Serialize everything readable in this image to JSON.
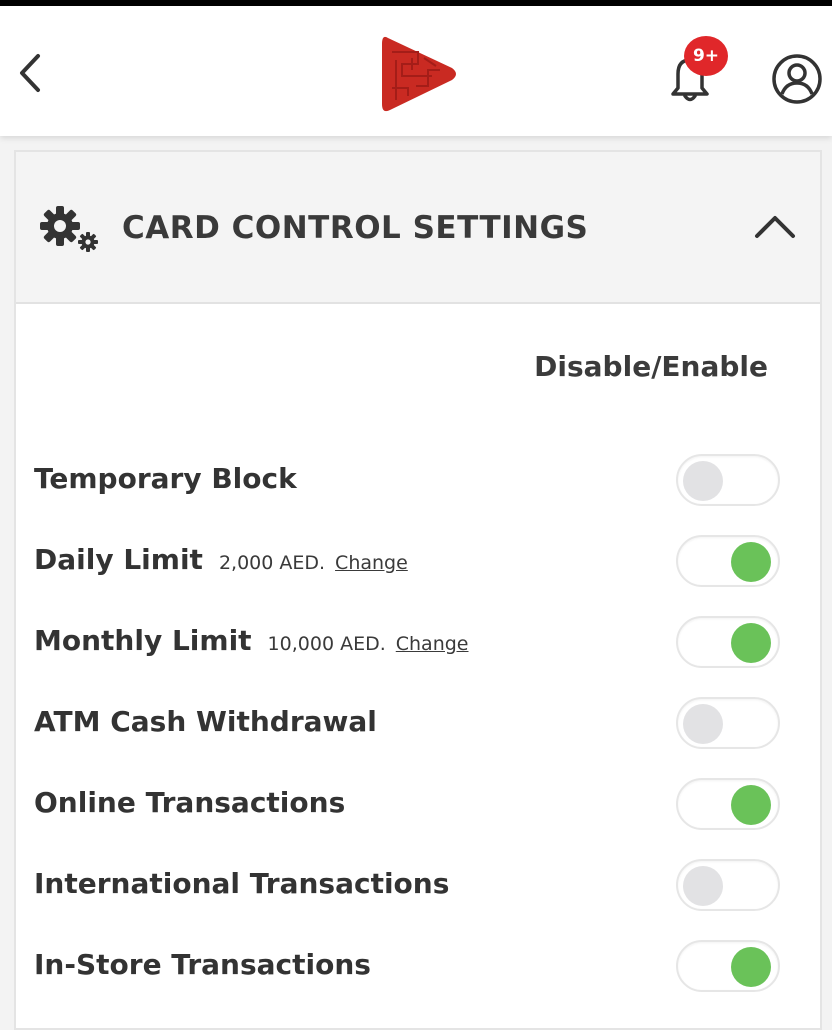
{
  "header": {
    "notification_badge": "9+",
    "icons": [
      "back-chevron-icon",
      "brand-play-logo",
      "bell-icon",
      "profile-icon"
    ]
  },
  "card": {
    "title": "CARD CONTROL SETTINGS",
    "column_header": "Disable/Enable",
    "rows": [
      {
        "label": "Temporary Block",
        "value": "",
        "link": "",
        "enabled": false
      },
      {
        "label": "Daily Limit",
        "value": "2,000 AED.",
        "link": "Change",
        "enabled": true
      },
      {
        "label": "Monthly Limit",
        "value": "10,000 AED.",
        "link": "Change",
        "enabled": true
      },
      {
        "label": "ATM Cash Withdrawal",
        "value": "",
        "link": "",
        "enabled": false
      },
      {
        "label": "Online Transactions",
        "value": "",
        "link": "",
        "enabled": true
      },
      {
        "label": "International Transactions",
        "value": "",
        "link": "",
        "enabled": false
      },
      {
        "label": "In-Store Transactions",
        "value": "",
        "link": "",
        "enabled": true
      }
    ]
  },
  "colors": {
    "toggle_on": "#6ac259",
    "toggle_off": "#e2e2e4",
    "badge": "#e0272a",
    "brand": "#c92a22"
  }
}
